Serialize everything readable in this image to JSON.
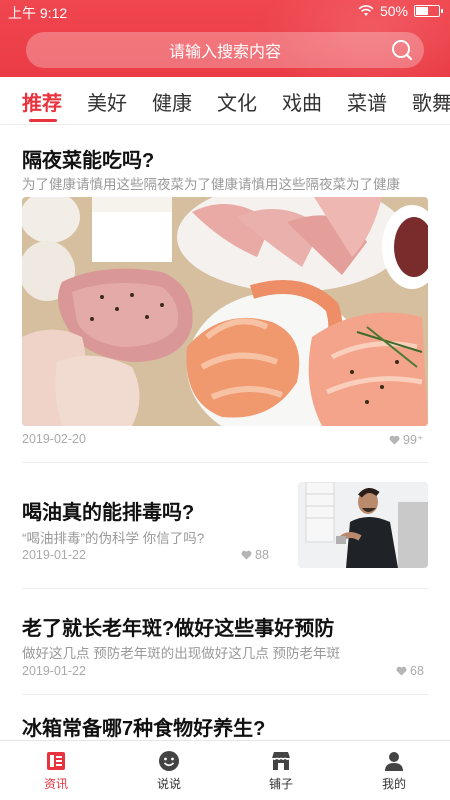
{
  "status_bar": {
    "time": "上午 9:12",
    "battery": "50%"
  },
  "search": {
    "placeholder": "请输入搜索内容"
  },
  "tabs": [
    {
      "label": "推荐",
      "active": true
    },
    {
      "label": "美好"
    },
    {
      "label": "健康"
    },
    {
      "label": "文化"
    },
    {
      "label": "戏曲"
    },
    {
      "label": "菜谱"
    },
    {
      "label": "歌舞"
    }
  ],
  "articles": [
    {
      "title": "隔夜菜能吃吗?",
      "subtitle": "为了健康请慎用这些隔夜菜为了健康请慎用这些隔夜菜为了健康",
      "date": "2019-02-20",
      "likes": "99⁺",
      "image": "food-spread-photo"
    },
    {
      "title": "喝油真的能排毒吗?",
      "subtitle": "“喝油排毒”的伪科学 你信了吗?",
      "date": "2019-01-22",
      "likes": "88",
      "image": "man-in-bathroom-photo"
    },
    {
      "title": "老了就长老年斑?做好这些事好预防",
      "subtitle": "做好这几点 预防老年斑的出现做好这几点 预防老年斑",
      "date": "2019-01-22",
      "likes": "68"
    },
    {
      "title": "冰箱常备哪7种食物好养生?"
    }
  ],
  "tabbar": [
    {
      "label": "资讯",
      "icon": "news-icon",
      "active": true
    },
    {
      "label": "说说",
      "icon": "chat-icon"
    },
    {
      "label": "铺子",
      "icon": "shop-icon"
    },
    {
      "label": "我的",
      "icon": "profile-icon"
    }
  ],
  "colors": {
    "brand_red": "#e8343e",
    "text_gray": "#999999"
  }
}
